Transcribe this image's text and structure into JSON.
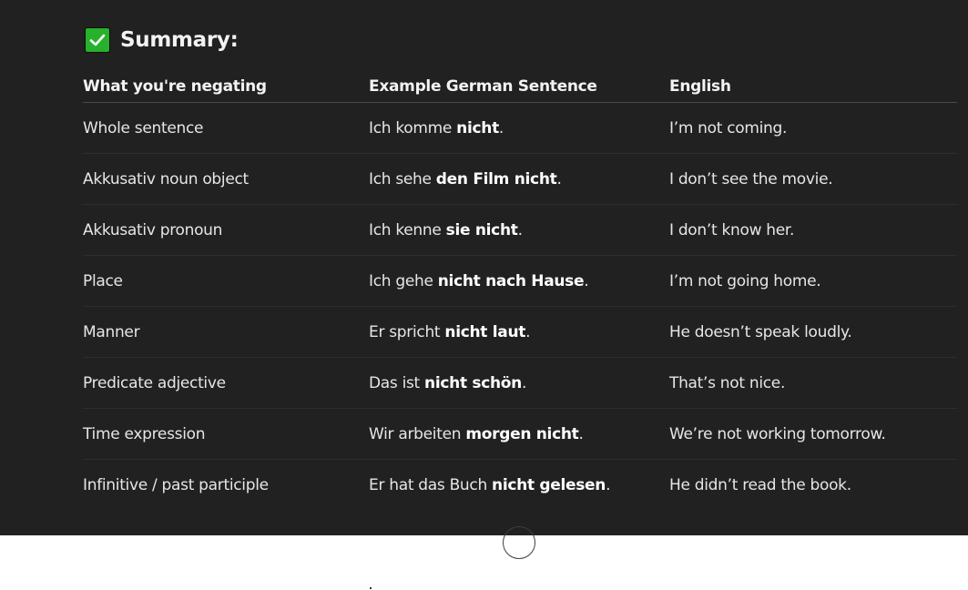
{
  "heading": {
    "icon": "check-mark-icon",
    "icon_color": "#27b12c",
    "title": "Summary:"
  },
  "table": {
    "headers": [
      "What you're negating",
      "Example German Sentence",
      "English"
    ],
    "rows": [
      {
        "what": "Whole sentence",
        "example": [
          {
            "text": "Ich komme ",
            "bold": false
          },
          {
            "text": "nicht",
            "bold": true
          },
          {
            "text": ".",
            "bold": false
          }
        ],
        "english": "I’m not coming."
      },
      {
        "what": "Akkusativ noun object",
        "example": [
          {
            "text": "Ich sehe ",
            "bold": false
          },
          {
            "text": "den Film nicht",
            "bold": true
          },
          {
            "text": ".",
            "bold": false
          }
        ],
        "english": "I don’t see the movie."
      },
      {
        "what": "Akkusativ pronoun",
        "example": [
          {
            "text": "Ich kenne ",
            "bold": false
          },
          {
            "text": "sie nicht",
            "bold": true
          },
          {
            "text": ".",
            "bold": false
          }
        ],
        "english": "I don’t know her."
      },
      {
        "what": "Place",
        "example": [
          {
            "text": "Ich gehe ",
            "bold": false
          },
          {
            "text": "nicht nach Hause",
            "bold": true
          },
          {
            "text": ".",
            "bold": false
          }
        ],
        "english": "I’m not going home."
      },
      {
        "what": "Manner",
        "example": [
          {
            "text": "Er spricht ",
            "bold": false
          },
          {
            "text": "nicht laut",
            "bold": true
          },
          {
            "text": ".",
            "bold": false
          }
        ],
        "english": "He doesn’t speak loudly."
      },
      {
        "what": "Predicate adjective",
        "example": [
          {
            "text": "Das ist ",
            "bold": false
          },
          {
            "text": "nicht schön",
            "bold": true
          },
          {
            "text": ".",
            "bold": false
          }
        ],
        "english": "That’s not nice."
      },
      {
        "what": "Time expression",
        "example": [
          {
            "text": "Wir arbeiten ",
            "bold": false
          },
          {
            "text": "morgen nicht",
            "bold": true
          },
          {
            "text": ".",
            "bold": false
          }
        ],
        "english": "We’re not working tomorrow."
      },
      {
        "what": "Infinitive / past participle",
        "example": [
          {
            "text": "Er hat das Buch ",
            "bold": false
          },
          {
            "text": "nicht gelesen",
            "bold": true
          },
          {
            "text": ".",
            "bold": false
          }
        ],
        "english": "He didn’t read the book."
      }
    ]
  },
  "scroll_button": {
    "icon": "scroll-down-icon"
  }
}
